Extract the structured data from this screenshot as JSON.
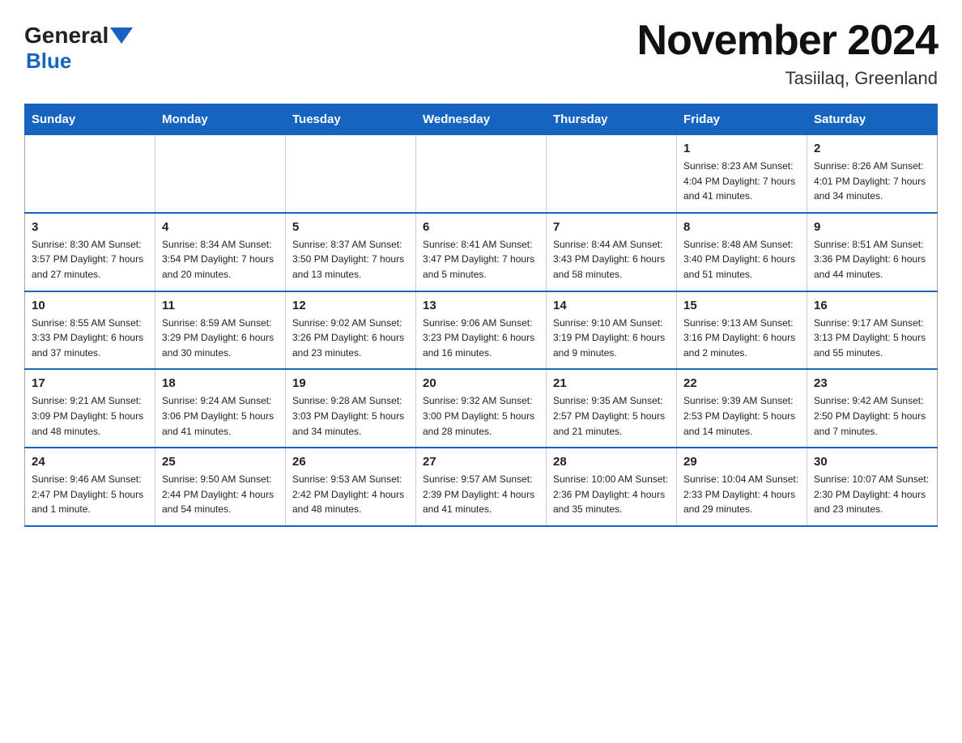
{
  "header": {
    "logo_general": "General",
    "logo_blue": "Blue",
    "title": "November 2024",
    "subtitle": "Tasiilaq, Greenland"
  },
  "days_of_week": [
    "Sunday",
    "Monday",
    "Tuesday",
    "Wednesday",
    "Thursday",
    "Friday",
    "Saturday"
  ],
  "weeks": [
    [
      {
        "day": "",
        "info": ""
      },
      {
        "day": "",
        "info": ""
      },
      {
        "day": "",
        "info": ""
      },
      {
        "day": "",
        "info": ""
      },
      {
        "day": "",
        "info": ""
      },
      {
        "day": "1",
        "info": "Sunrise: 8:23 AM\nSunset: 4:04 PM\nDaylight: 7 hours\nand 41 minutes."
      },
      {
        "day": "2",
        "info": "Sunrise: 8:26 AM\nSunset: 4:01 PM\nDaylight: 7 hours\nand 34 minutes."
      }
    ],
    [
      {
        "day": "3",
        "info": "Sunrise: 8:30 AM\nSunset: 3:57 PM\nDaylight: 7 hours\nand 27 minutes."
      },
      {
        "day": "4",
        "info": "Sunrise: 8:34 AM\nSunset: 3:54 PM\nDaylight: 7 hours\nand 20 minutes."
      },
      {
        "day": "5",
        "info": "Sunrise: 8:37 AM\nSunset: 3:50 PM\nDaylight: 7 hours\nand 13 minutes."
      },
      {
        "day": "6",
        "info": "Sunrise: 8:41 AM\nSunset: 3:47 PM\nDaylight: 7 hours\nand 5 minutes."
      },
      {
        "day": "7",
        "info": "Sunrise: 8:44 AM\nSunset: 3:43 PM\nDaylight: 6 hours\nand 58 minutes."
      },
      {
        "day": "8",
        "info": "Sunrise: 8:48 AM\nSunset: 3:40 PM\nDaylight: 6 hours\nand 51 minutes."
      },
      {
        "day": "9",
        "info": "Sunrise: 8:51 AM\nSunset: 3:36 PM\nDaylight: 6 hours\nand 44 minutes."
      }
    ],
    [
      {
        "day": "10",
        "info": "Sunrise: 8:55 AM\nSunset: 3:33 PM\nDaylight: 6 hours\nand 37 minutes."
      },
      {
        "day": "11",
        "info": "Sunrise: 8:59 AM\nSunset: 3:29 PM\nDaylight: 6 hours\nand 30 minutes."
      },
      {
        "day": "12",
        "info": "Sunrise: 9:02 AM\nSunset: 3:26 PM\nDaylight: 6 hours\nand 23 minutes."
      },
      {
        "day": "13",
        "info": "Sunrise: 9:06 AM\nSunset: 3:23 PM\nDaylight: 6 hours\nand 16 minutes."
      },
      {
        "day": "14",
        "info": "Sunrise: 9:10 AM\nSunset: 3:19 PM\nDaylight: 6 hours\nand 9 minutes."
      },
      {
        "day": "15",
        "info": "Sunrise: 9:13 AM\nSunset: 3:16 PM\nDaylight: 6 hours\nand 2 minutes."
      },
      {
        "day": "16",
        "info": "Sunrise: 9:17 AM\nSunset: 3:13 PM\nDaylight: 5 hours\nand 55 minutes."
      }
    ],
    [
      {
        "day": "17",
        "info": "Sunrise: 9:21 AM\nSunset: 3:09 PM\nDaylight: 5 hours\nand 48 minutes."
      },
      {
        "day": "18",
        "info": "Sunrise: 9:24 AM\nSunset: 3:06 PM\nDaylight: 5 hours\nand 41 minutes."
      },
      {
        "day": "19",
        "info": "Sunrise: 9:28 AM\nSunset: 3:03 PM\nDaylight: 5 hours\nand 34 minutes."
      },
      {
        "day": "20",
        "info": "Sunrise: 9:32 AM\nSunset: 3:00 PM\nDaylight: 5 hours\nand 28 minutes."
      },
      {
        "day": "21",
        "info": "Sunrise: 9:35 AM\nSunset: 2:57 PM\nDaylight: 5 hours\nand 21 minutes."
      },
      {
        "day": "22",
        "info": "Sunrise: 9:39 AM\nSunset: 2:53 PM\nDaylight: 5 hours\nand 14 minutes."
      },
      {
        "day": "23",
        "info": "Sunrise: 9:42 AM\nSunset: 2:50 PM\nDaylight: 5 hours\nand 7 minutes."
      }
    ],
    [
      {
        "day": "24",
        "info": "Sunrise: 9:46 AM\nSunset: 2:47 PM\nDaylight: 5 hours\nand 1 minute."
      },
      {
        "day": "25",
        "info": "Sunrise: 9:50 AM\nSunset: 2:44 PM\nDaylight: 4 hours\nand 54 minutes."
      },
      {
        "day": "26",
        "info": "Sunrise: 9:53 AM\nSunset: 2:42 PM\nDaylight: 4 hours\nand 48 minutes."
      },
      {
        "day": "27",
        "info": "Sunrise: 9:57 AM\nSunset: 2:39 PM\nDaylight: 4 hours\nand 41 minutes."
      },
      {
        "day": "28",
        "info": "Sunrise: 10:00 AM\nSunset: 2:36 PM\nDaylight: 4 hours\nand 35 minutes."
      },
      {
        "day": "29",
        "info": "Sunrise: 10:04 AM\nSunset: 2:33 PM\nDaylight: 4 hours\nand 29 minutes."
      },
      {
        "day": "30",
        "info": "Sunrise: 10:07 AM\nSunset: 2:30 PM\nDaylight: 4 hours\nand 23 minutes."
      }
    ]
  ]
}
